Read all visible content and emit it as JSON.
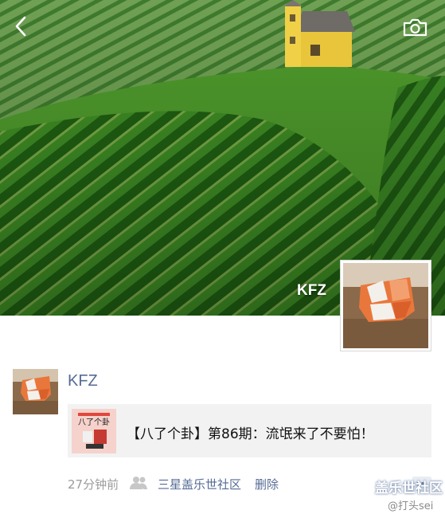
{
  "cover": {
    "profile_name": "KFZ",
    "back_icon": "chevron-left-icon",
    "camera_icon": "camera-icon"
  },
  "post": {
    "author": "KFZ",
    "link_title": "【八了个卦】第86期：流氓来了不要怕！",
    "thumb_tag": "八了个卦",
    "time": "27分钟前",
    "source": "三星盖乐世社区",
    "delete_label": "删除",
    "friends_icon": "friends-icon",
    "comment_icon": "comment-icon"
  },
  "watermark": {
    "main": "盖乐世社区",
    "sub": "@打头sei"
  },
  "colors": {
    "link_blue": "#576b95",
    "card_bg": "#f2f2f2",
    "meta_gray": "#9b9b9b"
  }
}
